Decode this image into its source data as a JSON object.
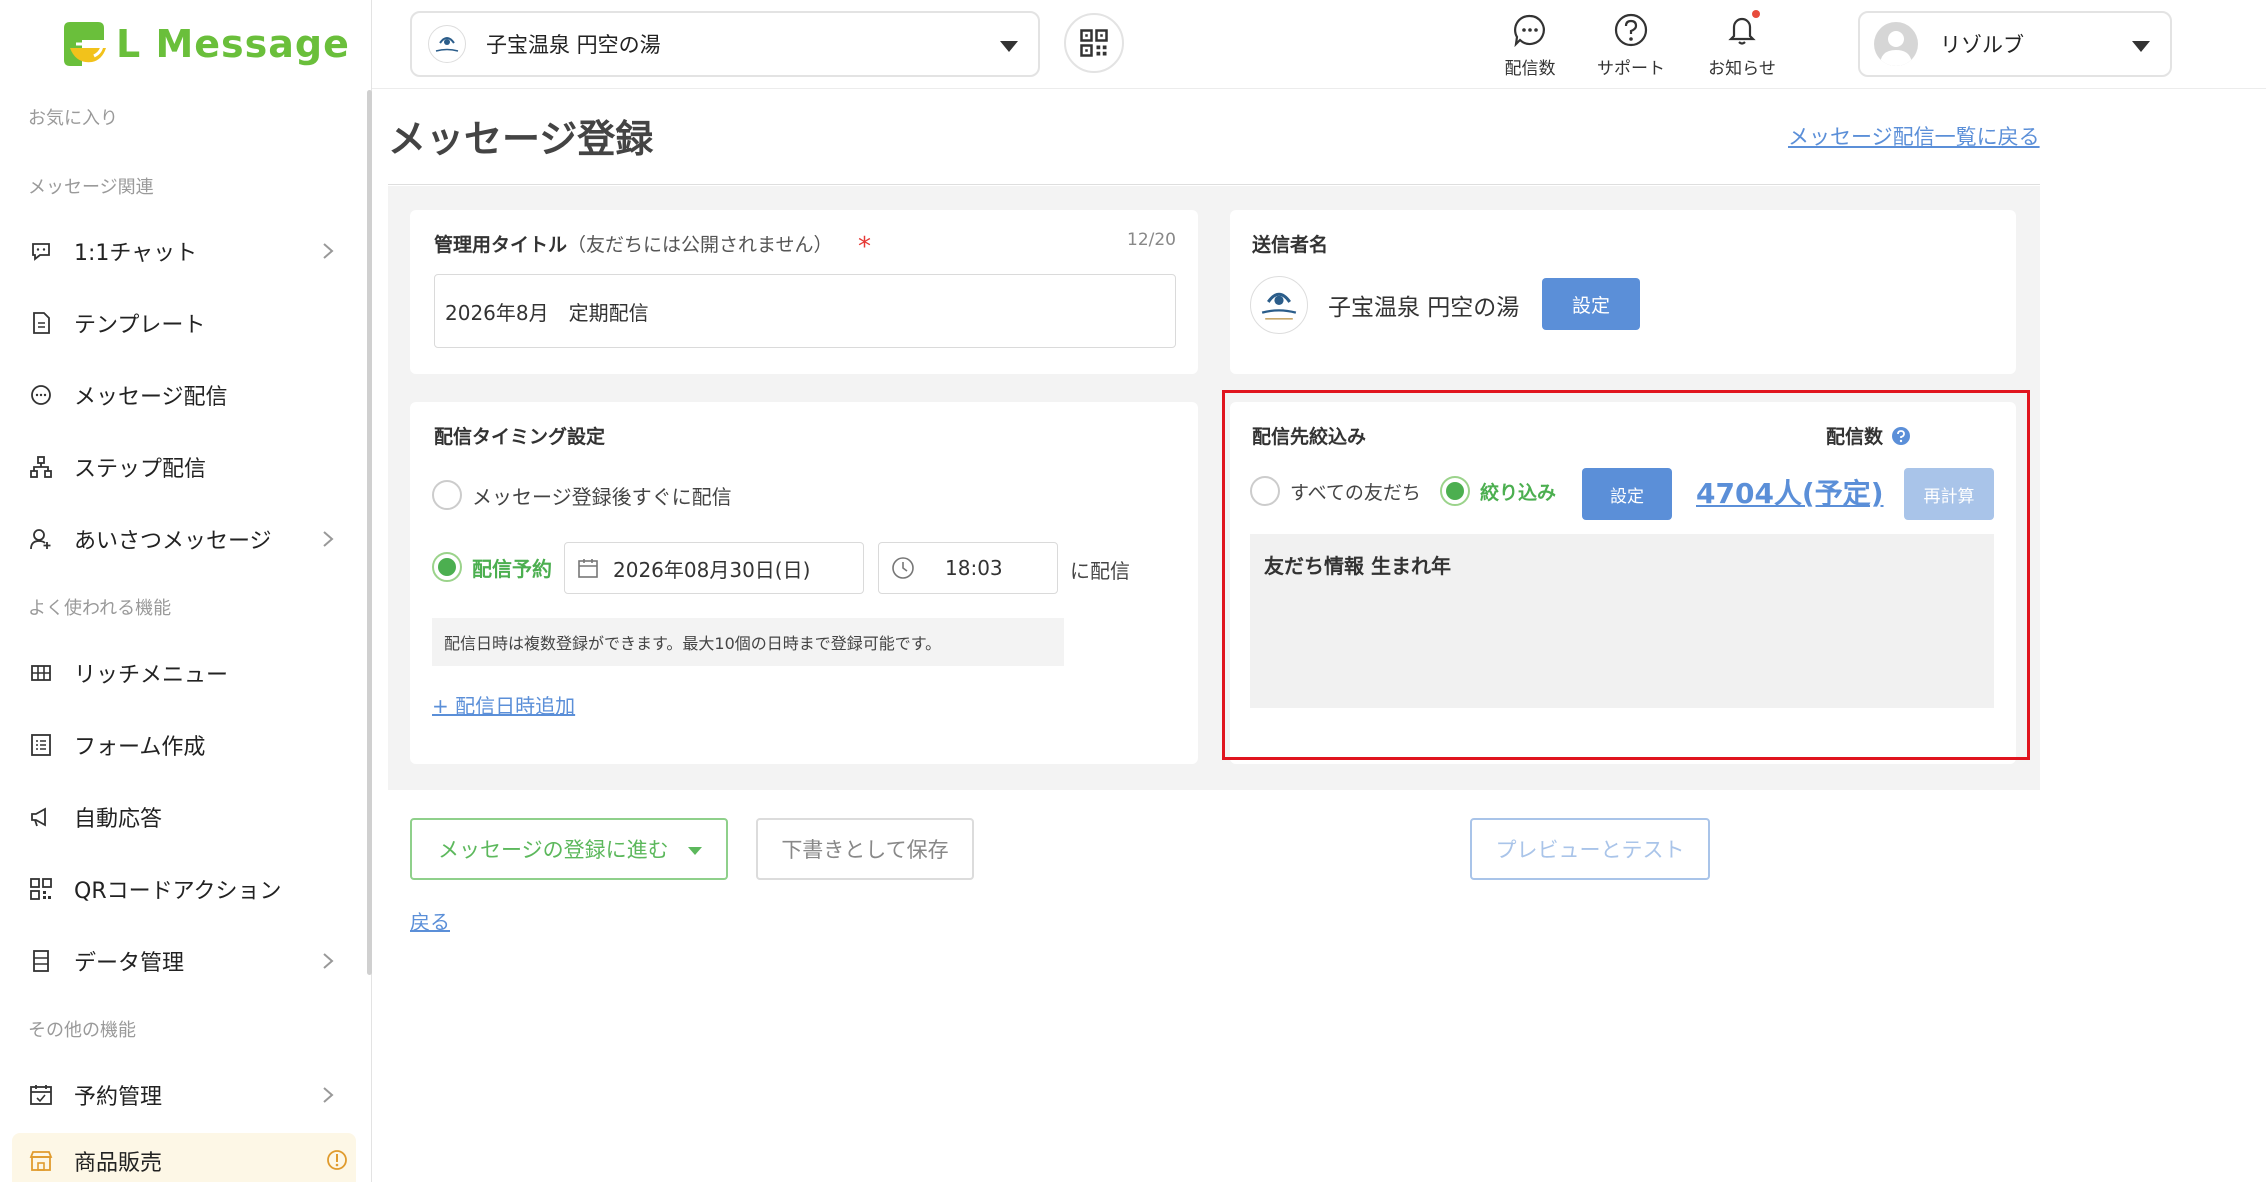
{
  "app": {
    "logo_text": "L Message"
  },
  "sidebar": {
    "sections": {
      "favorites": "お気に入り",
      "message": "メッセージ関連",
      "common": "よく使われる機能",
      "other": "その他の機能"
    },
    "items": [
      {
        "label": "1:1チャット",
        "icon": "chat-icon",
        "has_submenu": true
      },
      {
        "label": "テンプレート",
        "icon": "document-icon",
        "has_submenu": false
      },
      {
        "label": "メッセージ配信",
        "icon": "message-icon",
        "has_submenu": false
      },
      {
        "label": "ステップ配信",
        "icon": "hierarchy-icon",
        "has_submenu": false
      },
      {
        "label": "あいさつメッセージ",
        "icon": "user-add-icon",
        "has_submenu": true
      },
      {
        "label": "リッチメニュー",
        "icon": "grid-icon",
        "has_submenu": false
      },
      {
        "label": "フォーム作成",
        "icon": "form-icon",
        "has_submenu": false
      },
      {
        "label": "自動応答",
        "icon": "megaphone-icon",
        "has_submenu": false
      },
      {
        "label": "QRコードアクション",
        "icon": "qr-icon",
        "has_submenu": false
      },
      {
        "label": "データ管理",
        "icon": "database-icon",
        "has_submenu": true
      },
      {
        "label": "予約管理",
        "icon": "calendar-icon",
        "has_submenu": true
      },
      {
        "label": "商品販売",
        "icon": "store-icon",
        "has_submenu": false
      }
    ]
  },
  "topbar": {
    "account_name": "子宝温泉 円空の湯",
    "nav": [
      {
        "label": "配信数",
        "icon": "message-count-icon"
      },
      {
        "label": "サポート",
        "icon": "help-icon"
      },
      {
        "label": "お知らせ",
        "icon": "bell-icon"
      }
    ],
    "user_name": "リゾルブ"
  },
  "page": {
    "title": "メッセージ登録",
    "back_to_list": "メッセージ配信一覧に戻る"
  },
  "form": {
    "title_card": {
      "label": "管理用タイトル",
      "label_note": "（友だちには公開されません）",
      "required_mark": "*",
      "counter": "12/20",
      "value": "2026年8月　定期配信"
    },
    "sender_card": {
      "label": "送信者名",
      "name": "子宝温泉 円空の湯",
      "set_button": "設定"
    },
    "timing_card": {
      "label": "配信タイミング設定",
      "option_immediate": "メッセージ登録後すぐに配信",
      "option_scheduled": "配信予約",
      "selected": "scheduled",
      "date": "2026年08月30日(日)",
      "time": "18:03",
      "suffix": "に配信",
      "hint": "配信日時は複数登録ができます。最大10個の日時まで登録可能です。",
      "add_link": "+ 配信日時追加"
    },
    "target_card": {
      "label": "配信先絞込み",
      "count_label": "配信数",
      "option_all": "すべての友だち",
      "option_filter": "絞り込み",
      "selected": "filter",
      "set_button": "設定",
      "count_value": "4704人(予定)",
      "recalc_button": "再計算",
      "filter_condition": "友だち情報 生まれ年"
    }
  },
  "actions": {
    "proceed": "メッセージの登録に進む",
    "save_draft": "下書きとして保存",
    "preview_test": "プレビューとテスト",
    "back": "戻る"
  },
  "colors": {
    "brand_green": "#6abf3b",
    "primary_blue": "#5b8fd8",
    "light_blue": "#a9c4e9",
    "active_green": "#4caf50",
    "highlight_red": "#e0141e"
  }
}
